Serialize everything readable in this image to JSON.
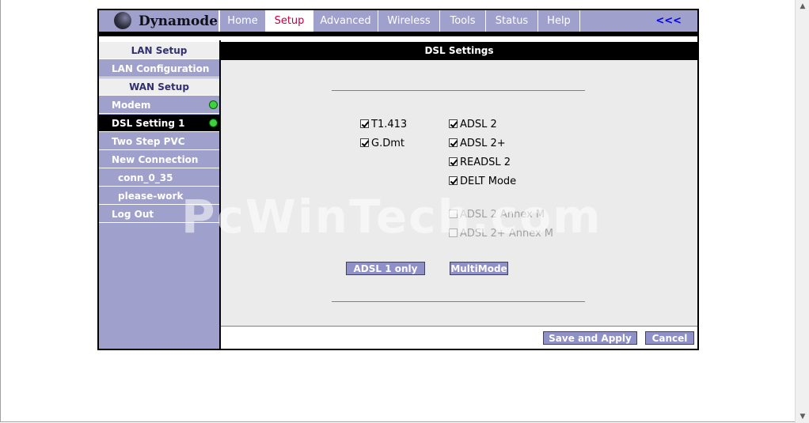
{
  "header": {
    "logo": "Dynamode",
    "tabs": [
      {
        "label": "Home"
      },
      {
        "label": "Setup"
      },
      {
        "label": "Advanced"
      },
      {
        "label": "Wireless"
      },
      {
        "label": "Tools"
      },
      {
        "label": "Status"
      },
      {
        "label": "Help"
      }
    ],
    "active_tab": "Setup",
    "back_link": "<<<"
  },
  "sidebar": {
    "items": [
      {
        "label": "LAN Setup",
        "type": "heading"
      },
      {
        "label": "LAN Configuration",
        "type": "link"
      },
      {
        "label": "WAN Setup",
        "type": "heading"
      },
      {
        "label": "Modem",
        "type": "link",
        "status": "connected"
      },
      {
        "label": "DSL Setting 1",
        "type": "link",
        "active": true,
        "status": "connected"
      },
      {
        "label": "Two Step PVC",
        "type": "link"
      },
      {
        "label": "New Connection",
        "type": "link"
      },
      {
        "label": "conn_0_35",
        "type": "sublink"
      },
      {
        "label": "please-work",
        "type": "sublink"
      },
      {
        "label": "Log Out",
        "type": "link"
      }
    ]
  },
  "main": {
    "title": "DSL Settings",
    "modes_left": [
      {
        "label": "T1.413",
        "checked": true
      },
      {
        "label": "G.Dmt",
        "checked": true
      }
    ],
    "modes_right": [
      {
        "label": "ADSL 2",
        "checked": true
      },
      {
        "label": "ADSL 2+",
        "checked": true
      },
      {
        "label": "READSL 2",
        "checked": true
      },
      {
        "label": "DELT Mode",
        "checked": true
      }
    ],
    "modes_disabled": [
      {
        "label": "ADSL 2 Annex M",
        "checked": false
      },
      {
        "label": "ADSL 2+ Annex M",
        "checked": false
      }
    ],
    "adsl1_button": "ADSL 1 only",
    "multimode_button": "MultiMode"
  },
  "footer": {
    "save_button": "Save and Apply",
    "cancel_button": "Cancel"
  },
  "watermark": "PcWinTech.com",
  "colors": {
    "accent": "#a0a0cc",
    "active_tab_text": "#c00040",
    "status_dot": "#40d040"
  }
}
